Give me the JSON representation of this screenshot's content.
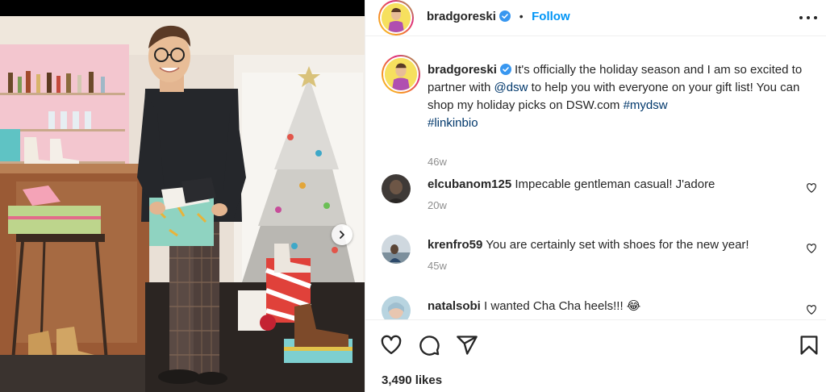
{
  "post": {
    "username": "bradgoreski",
    "follow_label": "Follow",
    "separator": "•"
  },
  "caption": {
    "username": "bradgoreski",
    "text_part1": " It's officially the holiday season and I am so excited to partner with ",
    "mention": "@dsw",
    "text_part2": " to help you with everyone on your gift list! You can shop my holiday picks on DSW.com ",
    "hashtag1": "#mydsw",
    "hashtag2": "#linkinbio",
    "time": "46w"
  },
  "comments": [
    {
      "username": "elcubanom125",
      "text": "Impecable gentleman casual! J'adore",
      "time": "20w"
    },
    {
      "username": "krenfro59",
      "text": "You are certainly set with shoes for the new year!",
      "time": "45w"
    },
    {
      "username": "natalsobi",
      "text": "I wanted Cha Cha heels!!! 😂",
      "time": ""
    }
  ],
  "likes": {
    "text": "3,490 likes"
  },
  "icons": {
    "verified": "verified-badge-icon",
    "more": "more-options-icon",
    "like": "heart-icon",
    "comment": "comment-icon",
    "share": "share-icon",
    "save": "bookmark-icon",
    "next": "chevron-right-icon"
  },
  "colors": {
    "accent": "#0095f6",
    "link": "#00376b",
    "muted": "#8e8e8e",
    "text": "#262626"
  }
}
